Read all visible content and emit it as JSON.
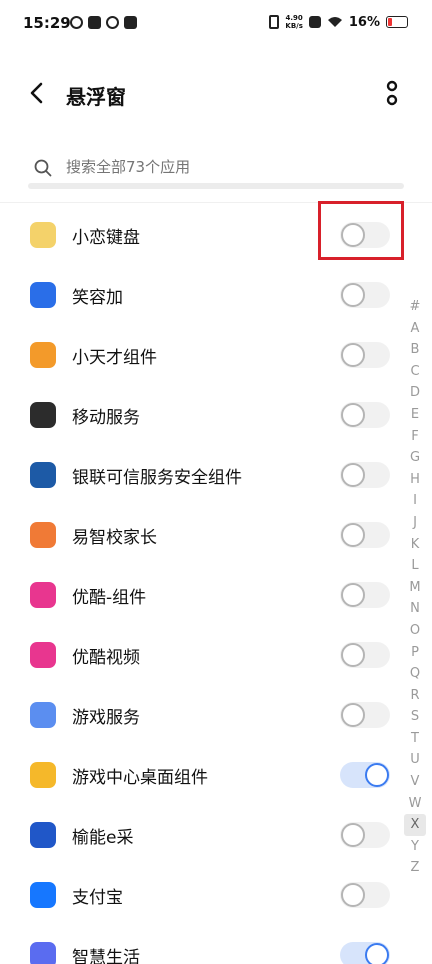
{
  "status_bar": {
    "time": "15:29",
    "speed_value": "4.90",
    "speed_unit": "KB/s",
    "battery": "16%"
  },
  "header": {
    "title": "悬浮窗"
  },
  "search": {
    "placeholder": "搜索全部73个应用"
  },
  "apps": [
    {
      "name": "小恋键盘",
      "icon": "keyboard-app-icon",
      "color": "#f4d26a",
      "enabled": false
    },
    {
      "name": "笑容加",
      "icon": "smile-app-icon",
      "color": "#2a6ee8",
      "enabled": false
    },
    {
      "name": "小天才组件",
      "icon": "kid-app-icon",
      "color": "#f39a2a",
      "enabled": false
    },
    {
      "name": "移动服务",
      "icon": "mobile-service-icon",
      "color": "#2c2c2c",
      "enabled": false
    },
    {
      "name": "银联可信服务安全组件",
      "icon": "unionpay-icon",
      "color": "#1d5aa6",
      "enabled": false
    },
    {
      "name": "易智校家长",
      "icon": "school-app-icon",
      "color": "#f07a36",
      "enabled": false
    },
    {
      "name": "优酷-组件",
      "icon": "youku-icon",
      "color": "#e8368f",
      "enabled": false
    },
    {
      "name": "优酷视频",
      "icon": "youku-video-icon",
      "color": "#e8368f",
      "enabled": false
    },
    {
      "name": "游戏服务",
      "icon": "game-service-icon",
      "color": "#5b8ef0",
      "enabled": false
    },
    {
      "name": "游戏中心桌面组件",
      "icon": "game-center-icon",
      "color": "#f5b82a",
      "enabled": true
    },
    {
      "name": "榆能e采",
      "icon": "yuneng-icon",
      "color": "#2057c8",
      "enabled": false
    },
    {
      "name": "支付宝",
      "icon": "alipay-icon",
      "color": "#1677ff",
      "enabled": false
    },
    {
      "name": "智慧生活",
      "icon": "smart-life-icon",
      "color": "#5a6cf0",
      "enabled": true
    }
  ],
  "alpha_index": [
    "#",
    "A",
    "B",
    "C",
    "D",
    "E",
    "F",
    "G",
    "H",
    "I",
    "J",
    "K",
    "L",
    "M",
    "N",
    "O",
    "P",
    "Q",
    "R",
    "S",
    "T",
    "U",
    "V",
    "W",
    "X",
    "Y",
    "Z"
  ],
  "alpha_active": "X",
  "colors": {
    "accent": "#3b7bf0",
    "highlight": "#d8202a"
  }
}
